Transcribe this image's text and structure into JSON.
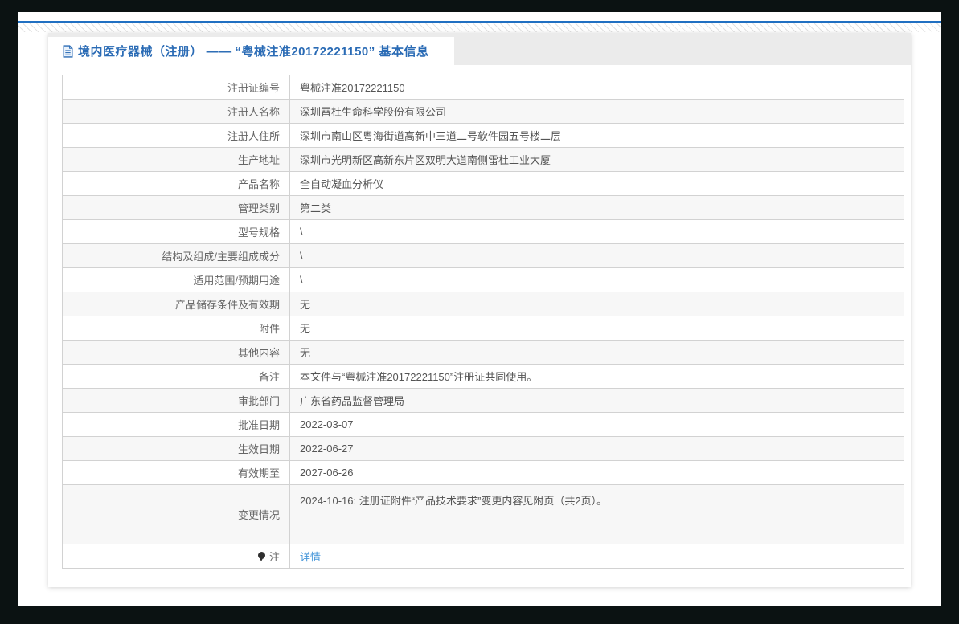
{
  "header": {
    "title": "境内医疗器械（注册） —— “粤械注准20172221150” 基本信息"
  },
  "table": {
    "rows": [
      {
        "label": "注册证编号",
        "value": "粤械注准20172221150"
      },
      {
        "label": "注册人名称",
        "value": "深圳雷杜生命科学股份有限公司"
      },
      {
        "label": "注册人住所",
        "value": "深圳市南山区粤海街道高新中三道二号软件园五号楼二层"
      },
      {
        "label": "生产地址",
        "value": "深圳市光明新区高新东片区双明大道南侧雷杜工业大厦"
      },
      {
        "label": "产品名称",
        "value": "全自动凝血分析仪"
      },
      {
        "label": "管理类别",
        "value": "第二类"
      },
      {
        "label": "型号规格",
        "value": "\\"
      },
      {
        "label": "结构及组成/主要组成成分",
        "value": "\\"
      },
      {
        "label": "适用范围/预期用途",
        "value": "\\"
      },
      {
        "label": "产品储存条件及有效期",
        "value": "无"
      },
      {
        "label": "附件",
        "value": "无"
      },
      {
        "label": "其他内容",
        "value": "无"
      },
      {
        "label": "备注",
        "value": "本文件与“粤械注准20172221150”注册证共同使用。"
      },
      {
        "label": "审批部门",
        "value": "广东省药品监督管理局"
      },
      {
        "label": "批准日期",
        "value": "2022-03-07"
      },
      {
        "label": "生效日期",
        "value": "2022-06-27"
      },
      {
        "label": "有效期至",
        "value": "2027-06-26"
      },
      {
        "label": "变更情况",
        "value": "2024-10-16: 注册证附件“产品技术要求”变更内容见附页（共2页）。",
        "tall": true
      },
      {
        "label": "注",
        "value": "详情",
        "link": true,
        "icon": "note-balloon-icon"
      }
    ]
  },
  "icons": {
    "title_icon": "document-icon",
    "note_icon": "note-balloon-icon"
  },
  "colors": {
    "accent_blue": "#2a6bb5",
    "link_blue": "#4596d9",
    "frame": "#0b1212",
    "header_band": "#ebebeb",
    "row_stripe": "#f7f7f7",
    "table_border": "#d2d2d2",
    "top_line": "#2170c2",
    "text": "#555555",
    "label_text": "#666666"
  }
}
